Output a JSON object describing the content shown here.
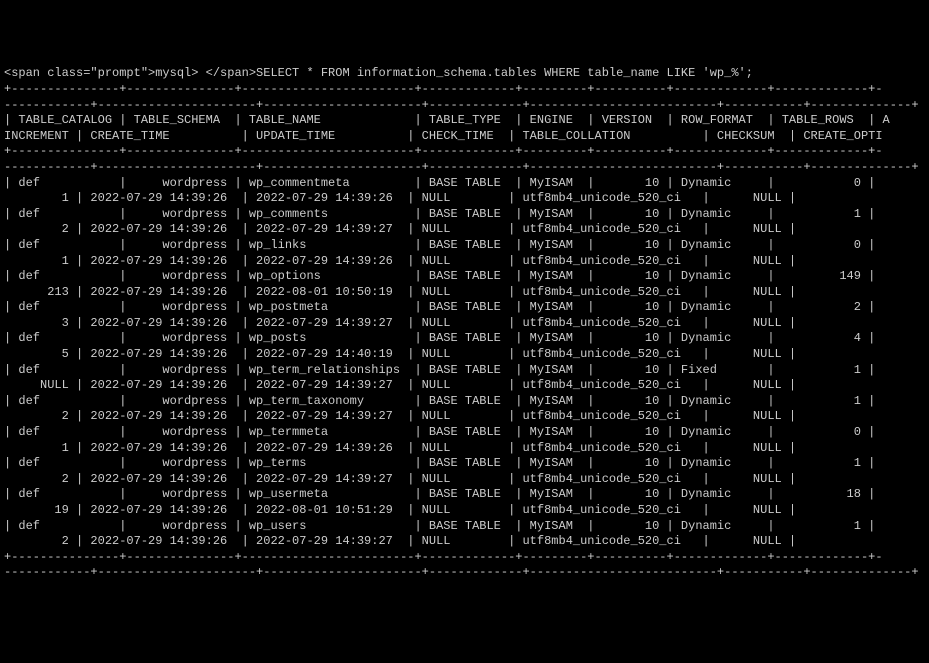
{
  "prompt": "mysql> ",
  "query": "SELECT * FROM information_schema.tables WHERE table_name LIKE 'wp_%';",
  "headers_row1": [
    "TABLE_CATALOG",
    "TABLE_SCHEMA",
    "TABLE_NAME",
    "TABLE_TYPE",
    "ENGINE",
    "VERSION",
    "ROW_FORMAT",
    "TABLE_ROWS",
    "A"
  ],
  "headers_row2": [
    "INCREMENT",
    "CREATE_TIME",
    "UPDATE_TIME",
    "CHECK_TIME",
    "TABLE_COLLATION",
    "CHECKSUM",
    "CREATE_OPTI"
  ],
  "rows": [
    {
      "catalog": "def",
      "schema": "wordpress",
      "name": "wp_commentmeta",
      "type": "BASE TABLE",
      "engine": "MyISAM",
      "version": "10",
      "row_format": "Dynamic",
      "table_rows": "0",
      "increment": "1",
      "create_time": "2022-07-29 14:39:26",
      "update_time": "2022-07-29 14:39:26",
      "check_time": "NULL",
      "collation": "utf8mb4_unicode_520_ci",
      "checksum": "NULL"
    },
    {
      "catalog": "def",
      "schema": "wordpress",
      "name": "wp_comments",
      "type": "BASE TABLE",
      "engine": "MyISAM",
      "version": "10",
      "row_format": "Dynamic",
      "table_rows": "1",
      "increment": "2",
      "create_time": "2022-07-29 14:39:26",
      "update_time": "2022-07-29 14:39:27",
      "check_time": "NULL",
      "collation": "utf8mb4_unicode_520_ci",
      "checksum": "NULL"
    },
    {
      "catalog": "def",
      "schema": "wordpress",
      "name": "wp_links",
      "type": "BASE TABLE",
      "engine": "MyISAM",
      "version": "10",
      "row_format": "Dynamic",
      "table_rows": "0",
      "increment": "1",
      "create_time": "2022-07-29 14:39:26",
      "update_time": "2022-07-29 14:39:26",
      "check_time": "NULL",
      "collation": "utf8mb4_unicode_520_ci",
      "checksum": "NULL"
    },
    {
      "catalog": "def",
      "schema": "wordpress",
      "name": "wp_options",
      "type": "BASE TABLE",
      "engine": "MyISAM",
      "version": "10",
      "row_format": "Dynamic",
      "table_rows": "149",
      "increment": "213",
      "create_time": "2022-07-29 14:39:26",
      "update_time": "2022-08-01 10:50:19",
      "check_time": "NULL",
      "collation": "utf8mb4_unicode_520_ci",
      "checksum": "NULL"
    },
    {
      "catalog": "def",
      "schema": "wordpress",
      "name": "wp_postmeta",
      "type": "BASE TABLE",
      "engine": "MyISAM",
      "version": "10",
      "row_format": "Dynamic",
      "table_rows": "2",
      "increment": "3",
      "create_time": "2022-07-29 14:39:26",
      "update_time": "2022-07-29 14:39:27",
      "check_time": "NULL",
      "collation": "utf8mb4_unicode_520_ci",
      "checksum": "NULL"
    },
    {
      "catalog": "def",
      "schema": "wordpress",
      "name": "wp_posts",
      "type": "BASE TABLE",
      "engine": "MyISAM",
      "version": "10",
      "row_format": "Dynamic",
      "table_rows": "4",
      "increment": "5",
      "create_time": "2022-07-29 14:39:26",
      "update_time": "2022-07-29 14:40:19",
      "check_time": "NULL",
      "collation": "utf8mb4_unicode_520_ci",
      "checksum": "NULL"
    },
    {
      "catalog": "def",
      "schema": "wordpress",
      "name": "wp_term_relationships",
      "type": "BASE TABLE",
      "engine": "MyISAM",
      "version": "10",
      "row_format": "Fixed",
      "table_rows": "1",
      "increment": "NULL",
      "create_time": "2022-07-29 14:39:26",
      "update_time": "2022-07-29 14:39:27",
      "check_time": "NULL",
      "collation": "utf8mb4_unicode_520_ci",
      "checksum": "NULL"
    },
    {
      "catalog": "def",
      "schema": "wordpress",
      "name": "wp_term_taxonomy",
      "type": "BASE TABLE",
      "engine": "MyISAM",
      "version": "10",
      "row_format": "Dynamic",
      "table_rows": "1",
      "increment": "2",
      "create_time": "2022-07-29 14:39:26",
      "update_time": "2022-07-29 14:39:27",
      "check_time": "NULL",
      "collation": "utf8mb4_unicode_520_ci",
      "checksum": "NULL"
    },
    {
      "catalog": "def",
      "schema": "wordpress",
      "name": "wp_termmeta",
      "type": "BASE TABLE",
      "engine": "MyISAM",
      "version": "10",
      "row_format": "Dynamic",
      "table_rows": "0",
      "increment": "1",
      "create_time": "2022-07-29 14:39:26",
      "update_time": "2022-07-29 14:39:26",
      "check_time": "NULL",
      "collation": "utf8mb4_unicode_520_ci",
      "checksum": "NULL"
    },
    {
      "catalog": "def",
      "schema": "wordpress",
      "name": "wp_terms",
      "type": "BASE TABLE",
      "engine": "MyISAM",
      "version": "10",
      "row_format": "Dynamic",
      "table_rows": "1",
      "increment": "2",
      "create_time": "2022-07-29 14:39:26",
      "update_time": "2022-07-29 14:39:27",
      "check_time": "NULL",
      "collation": "utf8mb4_unicode_520_ci",
      "checksum": "NULL"
    },
    {
      "catalog": "def",
      "schema": "wordpress",
      "name": "wp_usermeta",
      "type": "BASE TABLE",
      "engine": "MyISAM",
      "version": "10",
      "row_format": "Dynamic",
      "table_rows": "18",
      "increment": "19",
      "create_time": "2022-07-29 14:39:26",
      "update_time": "2022-08-01 10:51:29",
      "check_time": "NULL",
      "collation": "utf8mb4_unicode_520_ci",
      "checksum": "NULL"
    },
    {
      "catalog": "def",
      "schema": "wordpress",
      "name": "wp_users",
      "type": "BASE TABLE",
      "engine": "MyISAM",
      "version": "10",
      "row_format": "Dynamic",
      "table_rows": "1",
      "increment": "2",
      "create_time": "2022-07-29 14:39:26",
      "update_time": "2022-07-29 14:39:27",
      "check_time": "NULL",
      "collation": "utf8mb4_unicode_520_ci",
      "checksum": "NULL"
    }
  ],
  "col_widths": {
    "catalog": 13,
    "schema": 13,
    "name": 22,
    "type": 11,
    "engine": 7,
    "version": 8,
    "row_format": 11,
    "table_rows": 11,
    "increment": 9,
    "create_time": 20,
    "update_time": 20,
    "check_time": 11,
    "collation": 24,
    "checksum": 9,
    "create_opti": 12
  }
}
